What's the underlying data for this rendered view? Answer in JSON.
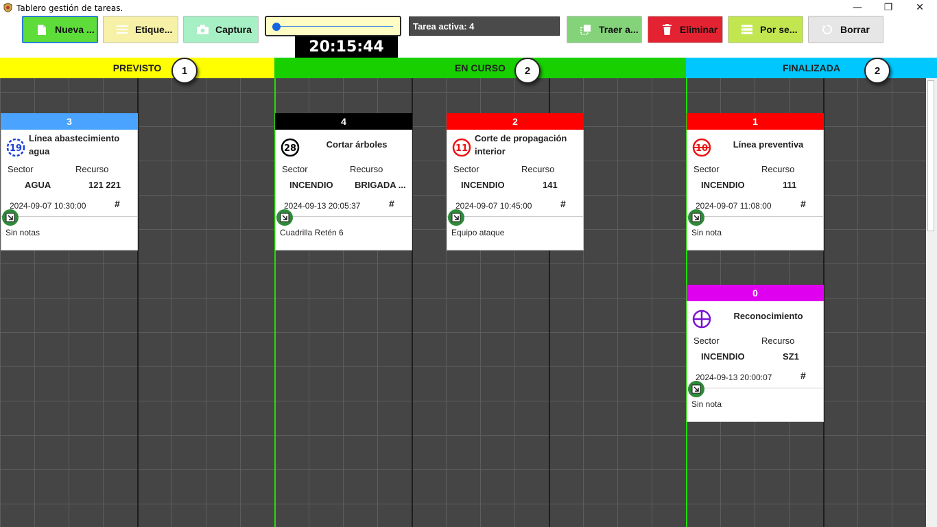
{
  "window": {
    "title": "Tablero gestión de tareas.",
    "minimize": "—",
    "restore": "❐",
    "close": "✕"
  },
  "toolbar": {
    "new_label": "Nueva ...",
    "labels_label": "Etique...",
    "capture_label": "Captura",
    "bring_label": "Traer a...",
    "delete_label": "Eliminar",
    "sort_label": "Por se...",
    "clear_label": "Borrar",
    "clock": "20:15:44",
    "active_task": "Tarea activa: 4",
    "slider_level": 0.03
  },
  "colors": {
    "new_btn": "#5ddc3a",
    "labels_btn": "#f7f1a8",
    "capture_btn": "#a7efc4",
    "bring_btn": "#84d37a",
    "delete_btn": "#e32232",
    "sort_btn": "#c2e64f",
    "clear_btn": "#e6e6e6",
    "prev": "#ffff00",
    "curso": "#18d000",
    "final": "#00c8ff"
  },
  "columns": [
    {
      "name": "PREVISTO",
      "count": "1"
    },
    {
      "name": "EN CURSO",
      "count": "2"
    },
    {
      "name": "FINALIZADA",
      "count": "2"
    }
  ],
  "cards": [
    {
      "id": "3",
      "header_color": "#4aa3ff",
      "icon": "circle-19-icon",
      "icon_num": "19",
      "title": "Línea abastecimiento agua",
      "sector_label": "Sector",
      "resource_label": "Recurso",
      "sector": "AGUA",
      "resource": "121 221",
      "date": "2024-09-07 10:30:00",
      "hash": "#",
      "note": "Sin notas"
    },
    {
      "id": "4",
      "header_color": "#000000",
      "icon": "circle-28-icon",
      "icon_num": "28",
      "title": "Cortar árboles",
      "sector_label": "Sector",
      "resource_label": "Recurso",
      "sector": "INCENDIO",
      "resource": "BRIGADA ...",
      "date": "2024-09-13 20:05:37",
      "hash": "#",
      "note": "Cuadrilla Retén 6"
    },
    {
      "id": "2",
      "header_color": "#ff0000",
      "icon": "circle-11-icon",
      "icon_num": "11",
      "title": "Corte de propagación interior",
      "sector_label": "Sector",
      "resource_label": "Recurso",
      "sector": "INCENDIO",
      "resource": "141",
      "date": "2024-09-07 10:45:00",
      "hash": "#",
      "note": "Equipo ataque"
    },
    {
      "id": "1",
      "header_color": "#ff0000",
      "icon": "crossed-circle-10-icon",
      "icon_num": "10",
      "title": "Línea preventiva",
      "sector_label": "Sector",
      "resource_label": "Recurso",
      "sector": "INCENDIO",
      "resource": "111",
      "date": "2024-09-07 11:08:00",
      "hash": "#",
      "note": "Sin nota"
    },
    {
      "id": "0",
      "header_color": "#e000f0",
      "icon": "crosshair-circle-icon",
      "icon_num": "",
      "title": "Reconocimiento",
      "sector_label": "Sector",
      "resource_label": "Recurso",
      "sector": "INCENDIO",
      "resource": "SZ1",
      "date": "2024-09-13 20:00:07",
      "hash": "#",
      "note": "Sin nota"
    }
  ]
}
